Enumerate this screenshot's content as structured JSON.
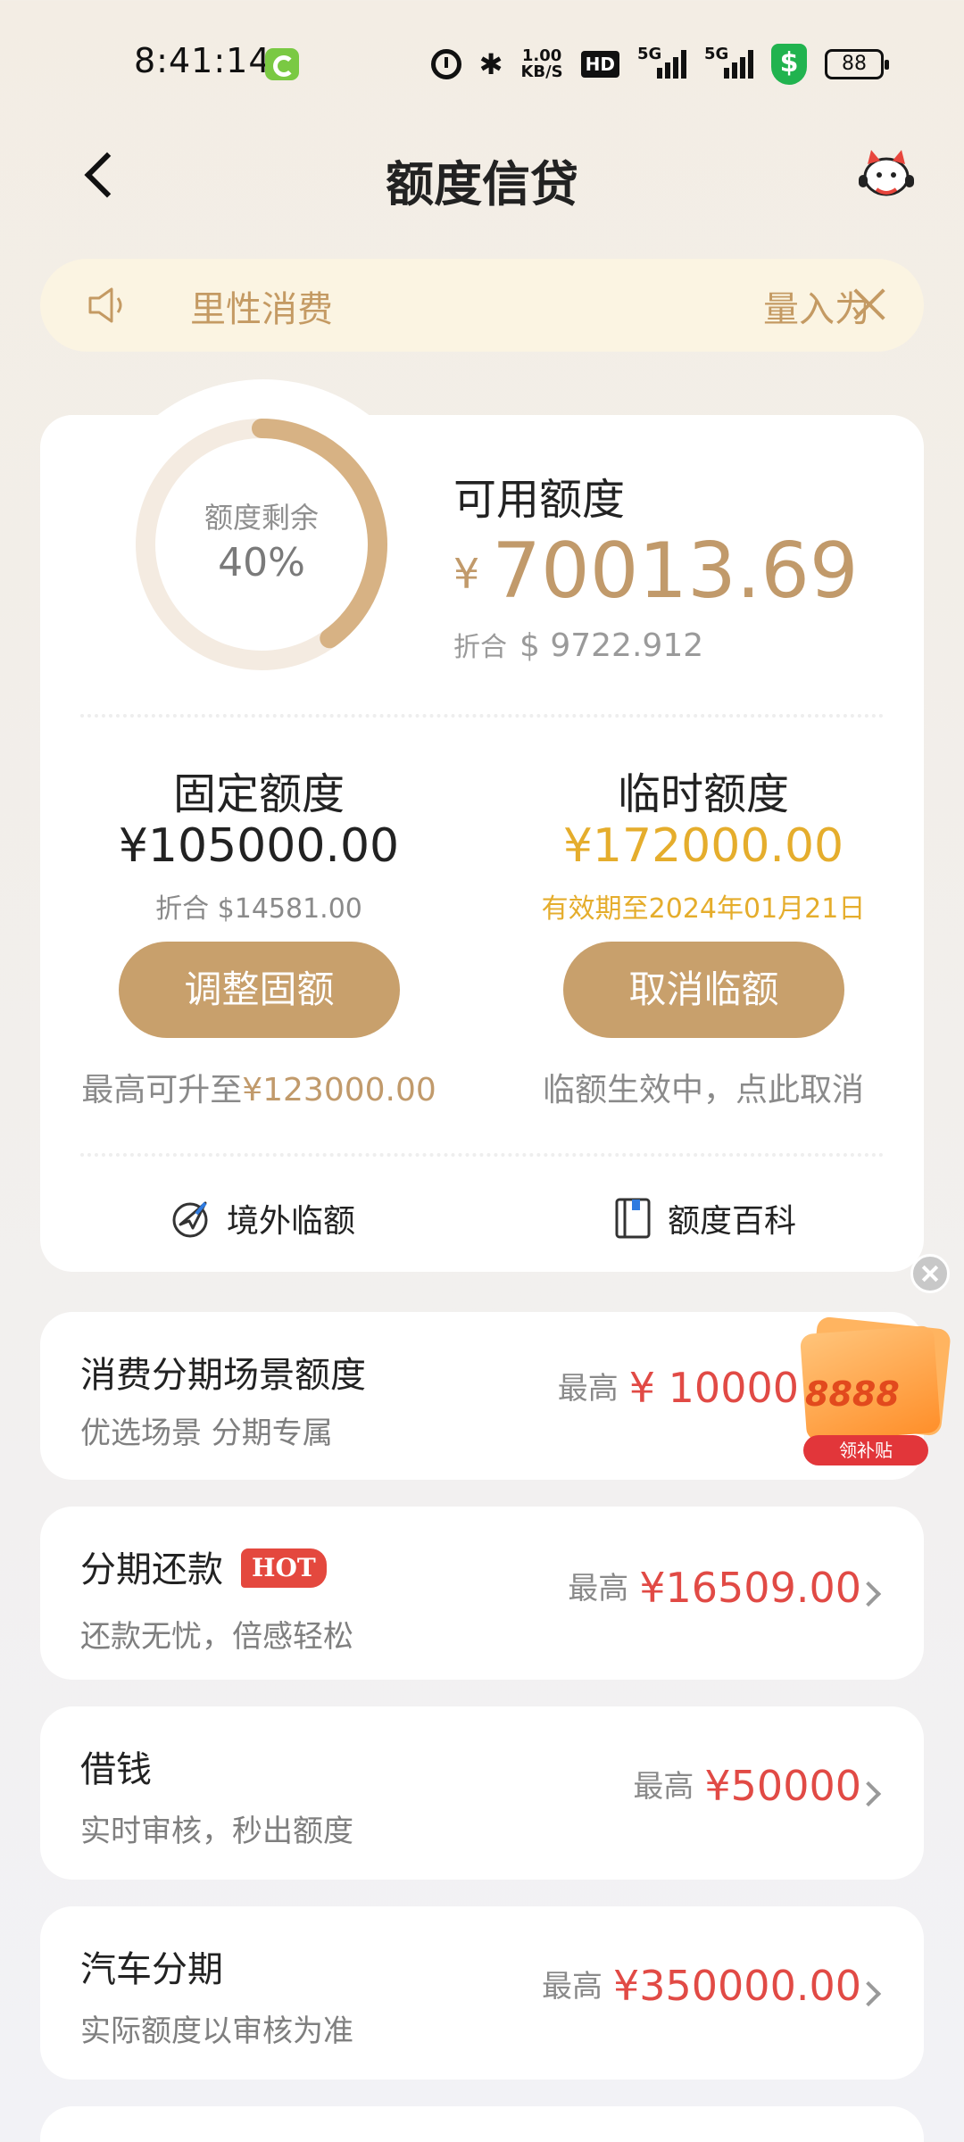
{
  "status_bar": {
    "time": "8:41:14",
    "net_speed_value": "1.00",
    "net_speed_unit": "KB/S",
    "hd_label": "HD",
    "sim1_label": "5G",
    "sim2_label": "5G",
    "shield_symbol": "$",
    "battery": "88"
  },
  "nav": {
    "title": "额度信贷"
  },
  "notice": {
    "text": "里性消费",
    "text_tail": "量入为出"
  },
  "credit": {
    "ring_label": "额度剩余",
    "ring_value": "40%",
    "ring_fraction": 0.4,
    "available_title": "可用额度",
    "available_currency": "¥",
    "available_amount": "70013.69",
    "available_usd_label": "折合",
    "available_usd": "$ 9722.912",
    "fixed": {
      "title": "固定额度",
      "amount": "¥105000.00",
      "sub": "折合 $14581.00",
      "button": "调整固额",
      "note_prefix": "最高可升至",
      "note_value": "¥123000.00"
    },
    "temp": {
      "title": "临时额度",
      "amount": "¥172000.00",
      "sub": "有效期至2024年01月21日",
      "button": "取消临额",
      "note": "临额生效中，点此取消"
    },
    "links": {
      "overseas": "境外临额",
      "wiki": "额度百科"
    }
  },
  "products": [
    {
      "title": "消费分期场景额度",
      "subtitle": "优选场景 分期专属",
      "prefix": "最高",
      "amount": "¥ 10000"
    },
    {
      "title": "分期还款",
      "badge": "HOT",
      "subtitle": "还款无忧，倍感轻松",
      "prefix": "最高",
      "amount": "¥16509.00"
    },
    {
      "title": "借钱",
      "subtitle": "实时审核，秒出额度",
      "prefix": "最高",
      "amount": "¥50000"
    },
    {
      "title": "汽车分期",
      "subtitle": "实际额度以审核为准",
      "prefix": "最高",
      "amount": "¥350000.00"
    }
  ],
  "promo": {
    "number": "8888",
    "tag": "领补贴"
  },
  "colors": {
    "accent_gold": "#c8a06c",
    "temp_amount": "#e5ad2c",
    "amount_red": "#e14a45",
    "hot_badge": "#e4483e"
  }
}
